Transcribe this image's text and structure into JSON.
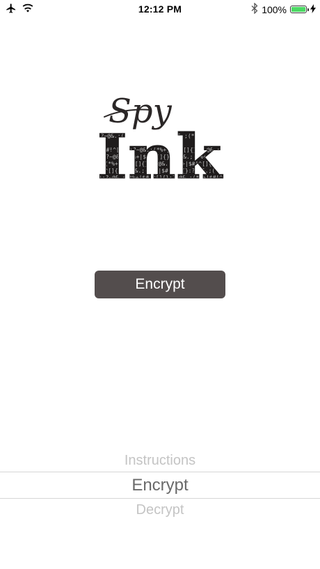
{
  "status_bar": {
    "time": "12:12 PM",
    "battery_text": "100%",
    "icons": [
      "airplane-icon",
      "wifi-icon",
      "bluetooth-icon",
      "battery-icon",
      "charging-icon"
    ],
    "battery_color": "#4cd964"
  },
  "logo": {
    "script_text": "Spy",
    "block_text": "Ink",
    "texture_glyphs": "@&.;(*%+|$#!^[]{}:?~@&.;(*%+|$#!^[]{}:?~@&.;(*%+|$#!^[]{}:?~"
  },
  "main": {
    "encrypt_button_label": "Encrypt",
    "button_color": "#534d4d"
  },
  "picker": {
    "items": [
      "Instructions",
      "Encrypt",
      "Decrypt"
    ],
    "selected_index": 1
  }
}
